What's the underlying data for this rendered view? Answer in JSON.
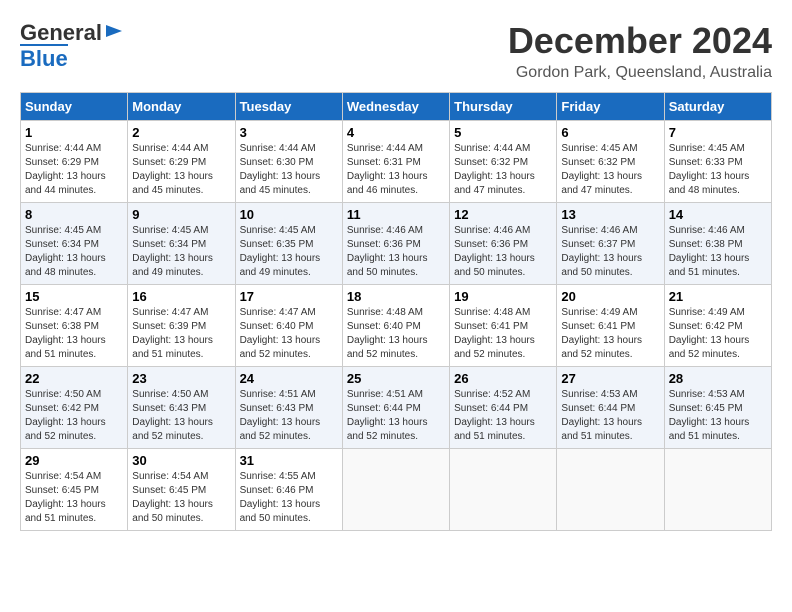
{
  "header": {
    "logo_line1": "General",
    "logo_line2": "Blue",
    "month": "December 2024",
    "location": "Gordon Park, Queensland, Australia"
  },
  "weekdays": [
    "Sunday",
    "Monday",
    "Tuesday",
    "Wednesday",
    "Thursday",
    "Friday",
    "Saturday"
  ],
  "weeks": [
    [
      {
        "day": "1",
        "sunrise": "4:44 AM",
        "sunset": "6:29 PM",
        "daylight": "13 hours and 44 minutes."
      },
      {
        "day": "2",
        "sunrise": "4:44 AM",
        "sunset": "6:29 PM",
        "daylight": "13 hours and 45 minutes."
      },
      {
        "day": "3",
        "sunrise": "4:44 AM",
        "sunset": "6:30 PM",
        "daylight": "13 hours and 45 minutes."
      },
      {
        "day": "4",
        "sunrise": "4:44 AM",
        "sunset": "6:31 PM",
        "daylight": "13 hours and 46 minutes."
      },
      {
        "day": "5",
        "sunrise": "4:44 AM",
        "sunset": "6:32 PM",
        "daylight": "13 hours and 47 minutes."
      },
      {
        "day": "6",
        "sunrise": "4:45 AM",
        "sunset": "6:32 PM",
        "daylight": "13 hours and 47 minutes."
      },
      {
        "day": "7",
        "sunrise": "4:45 AM",
        "sunset": "6:33 PM",
        "daylight": "13 hours and 48 minutes."
      }
    ],
    [
      {
        "day": "8",
        "sunrise": "4:45 AM",
        "sunset": "6:34 PM",
        "daylight": "13 hours and 48 minutes."
      },
      {
        "day": "9",
        "sunrise": "4:45 AM",
        "sunset": "6:34 PM",
        "daylight": "13 hours and 49 minutes."
      },
      {
        "day": "10",
        "sunrise": "4:45 AM",
        "sunset": "6:35 PM",
        "daylight": "13 hours and 49 minutes."
      },
      {
        "day": "11",
        "sunrise": "4:46 AM",
        "sunset": "6:36 PM",
        "daylight": "13 hours and 50 minutes."
      },
      {
        "day": "12",
        "sunrise": "4:46 AM",
        "sunset": "6:36 PM",
        "daylight": "13 hours and 50 minutes."
      },
      {
        "day": "13",
        "sunrise": "4:46 AM",
        "sunset": "6:37 PM",
        "daylight": "13 hours and 50 minutes."
      },
      {
        "day": "14",
        "sunrise": "4:46 AM",
        "sunset": "6:38 PM",
        "daylight": "13 hours and 51 minutes."
      }
    ],
    [
      {
        "day": "15",
        "sunrise": "4:47 AM",
        "sunset": "6:38 PM",
        "daylight": "13 hours and 51 minutes."
      },
      {
        "day": "16",
        "sunrise": "4:47 AM",
        "sunset": "6:39 PM",
        "daylight": "13 hours and 51 minutes."
      },
      {
        "day": "17",
        "sunrise": "4:47 AM",
        "sunset": "6:40 PM",
        "daylight": "13 hours and 52 minutes."
      },
      {
        "day": "18",
        "sunrise": "4:48 AM",
        "sunset": "6:40 PM",
        "daylight": "13 hours and 52 minutes."
      },
      {
        "day": "19",
        "sunrise": "4:48 AM",
        "sunset": "6:41 PM",
        "daylight": "13 hours and 52 minutes."
      },
      {
        "day": "20",
        "sunrise": "4:49 AM",
        "sunset": "6:41 PM",
        "daylight": "13 hours and 52 minutes."
      },
      {
        "day": "21",
        "sunrise": "4:49 AM",
        "sunset": "6:42 PM",
        "daylight": "13 hours and 52 minutes."
      }
    ],
    [
      {
        "day": "22",
        "sunrise": "4:50 AM",
        "sunset": "6:42 PM",
        "daylight": "13 hours and 52 minutes."
      },
      {
        "day": "23",
        "sunrise": "4:50 AM",
        "sunset": "6:43 PM",
        "daylight": "13 hours and 52 minutes."
      },
      {
        "day": "24",
        "sunrise": "4:51 AM",
        "sunset": "6:43 PM",
        "daylight": "13 hours and 52 minutes."
      },
      {
        "day": "25",
        "sunrise": "4:51 AM",
        "sunset": "6:44 PM",
        "daylight": "13 hours and 52 minutes."
      },
      {
        "day": "26",
        "sunrise": "4:52 AM",
        "sunset": "6:44 PM",
        "daylight": "13 hours and 51 minutes."
      },
      {
        "day": "27",
        "sunrise": "4:53 AM",
        "sunset": "6:44 PM",
        "daylight": "13 hours and 51 minutes."
      },
      {
        "day": "28",
        "sunrise": "4:53 AM",
        "sunset": "6:45 PM",
        "daylight": "13 hours and 51 minutes."
      }
    ],
    [
      {
        "day": "29",
        "sunrise": "4:54 AM",
        "sunset": "6:45 PM",
        "daylight": "13 hours and 51 minutes."
      },
      {
        "day": "30",
        "sunrise": "4:54 AM",
        "sunset": "6:45 PM",
        "daylight": "13 hours and 50 minutes."
      },
      {
        "day": "31",
        "sunrise": "4:55 AM",
        "sunset": "6:46 PM",
        "daylight": "13 hours and 50 minutes."
      },
      null,
      null,
      null,
      null
    ]
  ],
  "labels": {
    "sunrise": "Sunrise: ",
    "sunset": "Sunset: ",
    "daylight": "Daylight: "
  }
}
